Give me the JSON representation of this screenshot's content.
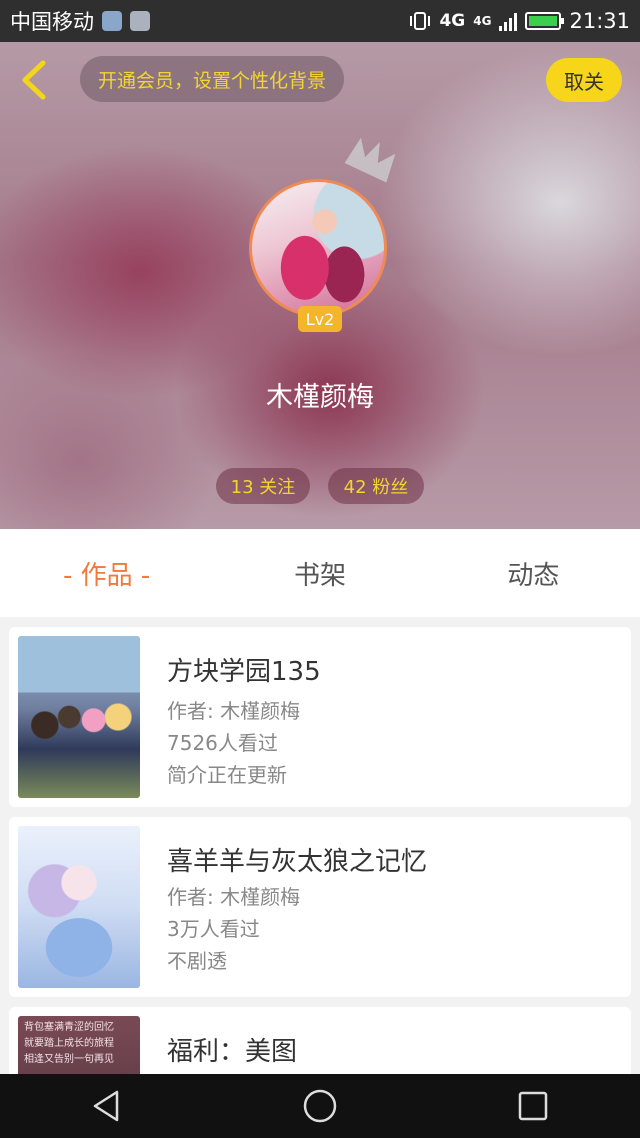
{
  "status_bar": {
    "carrier": "中国移动",
    "network_1": "4G",
    "network_2": "4G",
    "time": "21:31"
  },
  "header": {
    "vip_banner": "开通会员，设置个性化背景",
    "unfollow_label": "取关",
    "level_badge": "Lv2",
    "username": "木槿颜梅",
    "following": "13 关注",
    "fans": "42 粉丝"
  },
  "tabs": [
    {
      "label": "- 作品 -",
      "active": true
    },
    {
      "label": "书架",
      "active": false
    },
    {
      "label": "动态",
      "active": false
    }
  ],
  "works": [
    {
      "title": "方块学园135",
      "author": "作者: 木槿颜梅",
      "views": "7526人看过",
      "intro": "简介正在更新"
    },
    {
      "title": "喜羊羊与灰太狼之记忆",
      "author": "作者: 木槿颜梅",
      "views": "3万人看过",
      "intro": "不剧透"
    },
    {
      "title": "福利：美图",
      "cover_text": [
        "背包塞满青涩的回忆",
        "就要踏上成长的旅程",
        "相逢又告别一句再见"
      ]
    }
  ],
  "colors": {
    "accent": "#f07a3e",
    "vip_text": "#f3d531",
    "unfollow_bg": "#f7d51b",
    "level_badge": "#f5b52a"
  },
  "icons": {
    "back": "back-arrow-icon",
    "crown": "crown-icon",
    "nav_back": "nav-back-icon",
    "nav_home": "nav-home-icon",
    "nav_recent": "nav-recent-icon"
  }
}
